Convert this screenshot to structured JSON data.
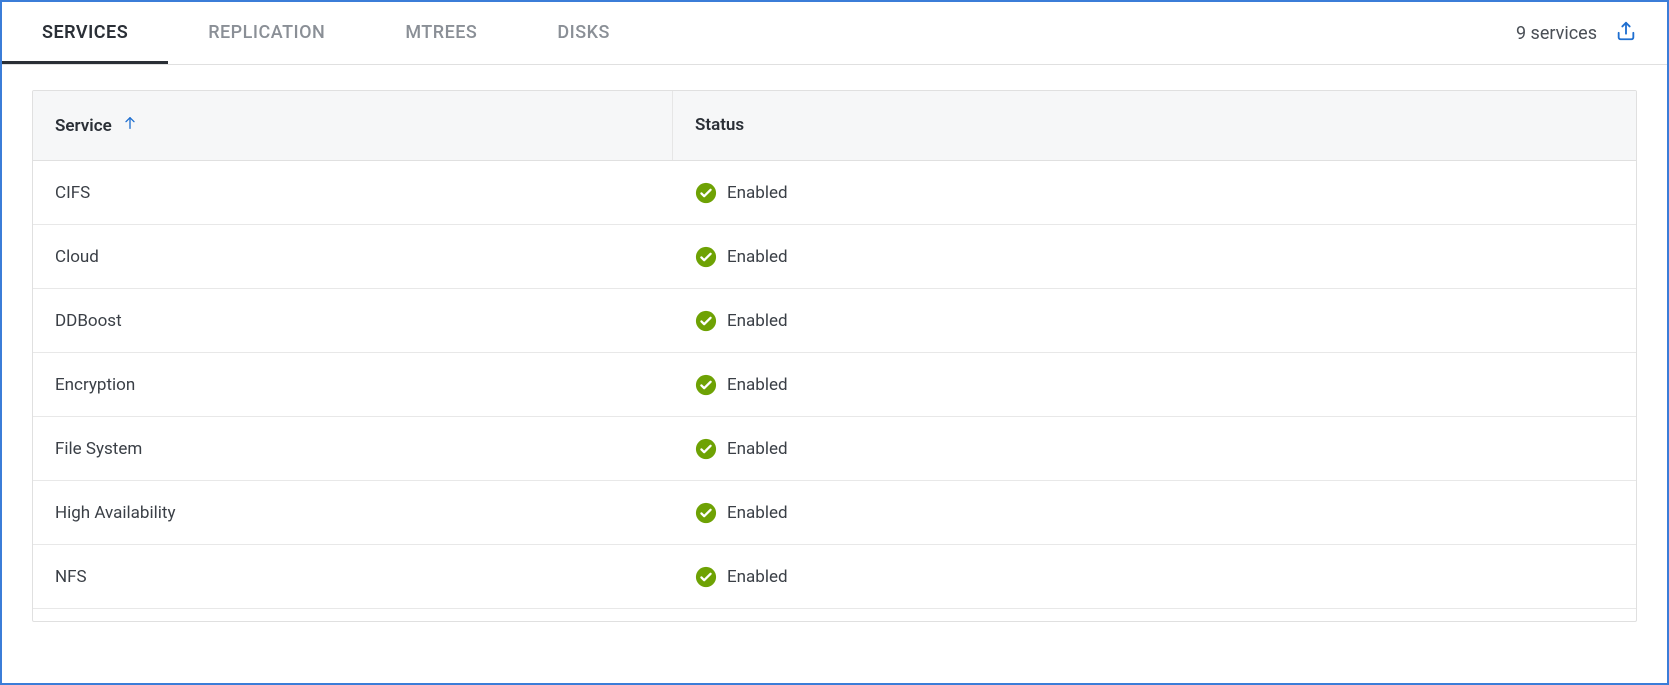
{
  "tabs": [
    {
      "label": "SERVICES",
      "active": true
    },
    {
      "label": "REPLICATION",
      "active": false
    },
    {
      "label": "MTREES",
      "active": false
    },
    {
      "label": "DISKS",
      "active": false
    }
  ],
  "summary": {
    "count_text": "9 services"
  },
  "icons": {
    "export": "export-icon",
    "sort_asc": "arrow-up-icon",
    "check": "check-circle-icon"
  },
  "columns": {
    "service": "Service",
    "status": "Status"
  },
  "sort": {
    "column": "service",
    "direction": "asc"
  },
  "rows": [
    {
      "service": "CIFS",
      "status": "Enabled",
      "status_color": "#6ea204"
    },
    {
      "service": "Cloud",
      "status": "Enabled",
      "status_color": "#6ea204"
    },
    {
      "service": "DDBoost",
      "status": "Enabled",
      "status_color": "#6ea204"
    },
    {
      "service": "Encryption",
      "status": "Enabled",
      "status_color": "#6ea204"
    },
    {
      "service": "File System",
      "status": "Enabled",
      "status_color": "#6ea204"
    },
    {
      "service": "High Availability",
      "status": "Enabled",
      "status_color": "#6ea204"
    },
    {
      "service": "NFS",
      "status": "Enabled",
      "status_color": "#6ea204"
    }
  ]
}
